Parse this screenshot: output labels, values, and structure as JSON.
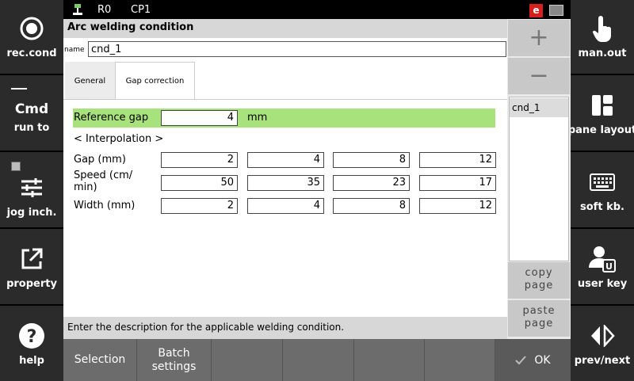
{
  "left_sidebar": [
    {
      "label": "rec.cond",
      "icon": "record-icon"
    },
    {
      "label": "run to",
      "title": "Cmd",
      "icon": "cmd-icon"
    },
    {
      "label": "jog inch.",
      "icon": "sliders-icon"
    },
    {
      "label": "property",
      "icon": "external-link-icon"
    },
    {
      "label": "help",
      "icon": "help-icon"
    }
  ],
  "right_sidebar": [
    {
      "label": "man.out",
      "icon": "hand-pointer-icon"
    },
    {
      "label": "pane layout",
      "icon": "layout-icon"
    },
    {
      "label": "soft kb.",
      "icon": "keyboard-icon"
    },
    {
      "label": "user key",
      "icon": "user-key-icon"
    },
    {
      "label": "prev/next",
      "icon": "prev-next-icon"
    }
  ],
  "topbar": {
    "robot": "R0",
    "program": "CP1",
    "mode_badge": "e"
  },
  "window": {
    "title": "Arc welding condition"
  },
  "name_field": {
    "label": "name",
    "value": "cnd_1"
  },
  "tabs": [
    {
      "label": "General",
      "active": false
    },
    {
      "label": "Gap correction",
      "active": true
    }
  ],
  "reference": {
    "label": "Reference gap",
    "value": "4",
    "unit": "mm"
  },
  "interpolation_label": "< Interpolation >",
  "rows": [
    {
      "label": "Gap (mm)",
      "values": [
        "2",
        "4",
        "8",
        "12"
      ]
    },
    {
      "label": "Speed (cm/\nmin)",
      "values": [
        "50",
        "35",
        "23",
        "17"
      ]
    },
    {
      "label": "Width (mm)",
      "values": [
        "2",
        "4",
        "8",
        "12"
      ]
    }
  ],
  "status_text": "Enter the description for the applicable welding condition.",
  "list": {
    "items": [
      "cnd_1"
    ]
  },
  "side_actions": {
    "add": "+",
    "remove": "−",
    "copy": "copy\npage",
    "paste": "paste\npage"
  },
  "bottom_bar": {
    "selection": "Selection",
    "batch": "Batch\nsettings",
    "ok": "OK"
  },
  "colors": {
    "highlight": "#a8e27c",
    "panel": "#2b2b2b",
    "badge": "#d61f1f"
  }
}
